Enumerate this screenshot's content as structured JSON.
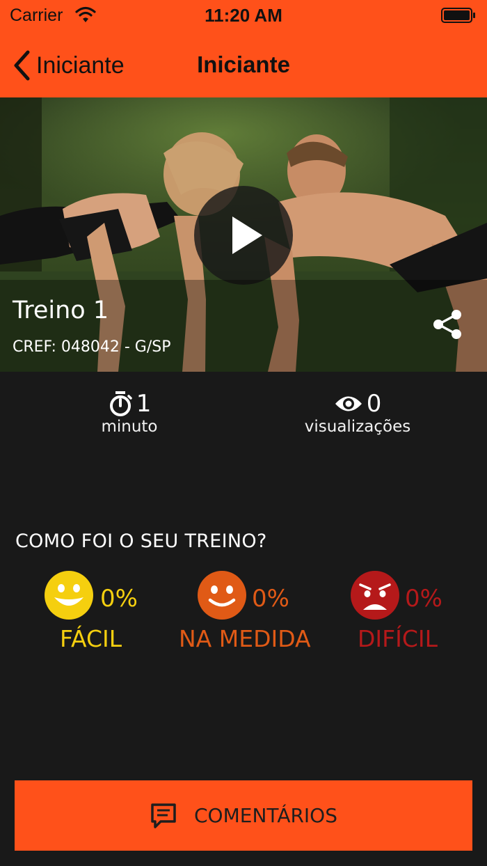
{
  "status_bar": {
    "carrier": "Carrier",
    "time": "11:20 AM"
  },
  "nav": {
    "back_label": "Iniciante",
    "title": "Iniciante"
  },
  "video": {
    "title": "Treino 1",
    "cref": "CREF: 048042 - G/SP"
  },
  "stats": {
    "duration": {
      "value": "1",
      "label": "minuto"
    },
    "views": {
      "value": "0",
      "label": "visualizações"
    }
  },
  "feedback": {
    "question": "COMO FOI O SEU TREINO?",
    "options": [
      {
        "percent": "0%",
        "label": "FÁCIL",
        "color": "#f5cf0f"
      },
      {
        "percent": "0%",
        "label": "NA MEDIDA",
        "color": "#e05a16"
      },
      {
        "percent": "0%",
        "label": "DIFÍCIL",
        "color": "#b5191a"
      }
    ]
  },
  "comments_button": {
    "label": "COMENTÁRIOS"
  },
  "colors": {
    "accent": "#ff511a",
    "background": "#191919"
  },
  "icons": [
    "wifi-icon",
    "battery-icon",
    "chevron-left-icon",
    "play-icon",
    "share-icon",
    "stopwatch-icon",
    "eye-icon",
    "happy-face-icon",
    "smile-face-icon",
    "sad-face-icon",
    "comment-icon"
  ]
}
